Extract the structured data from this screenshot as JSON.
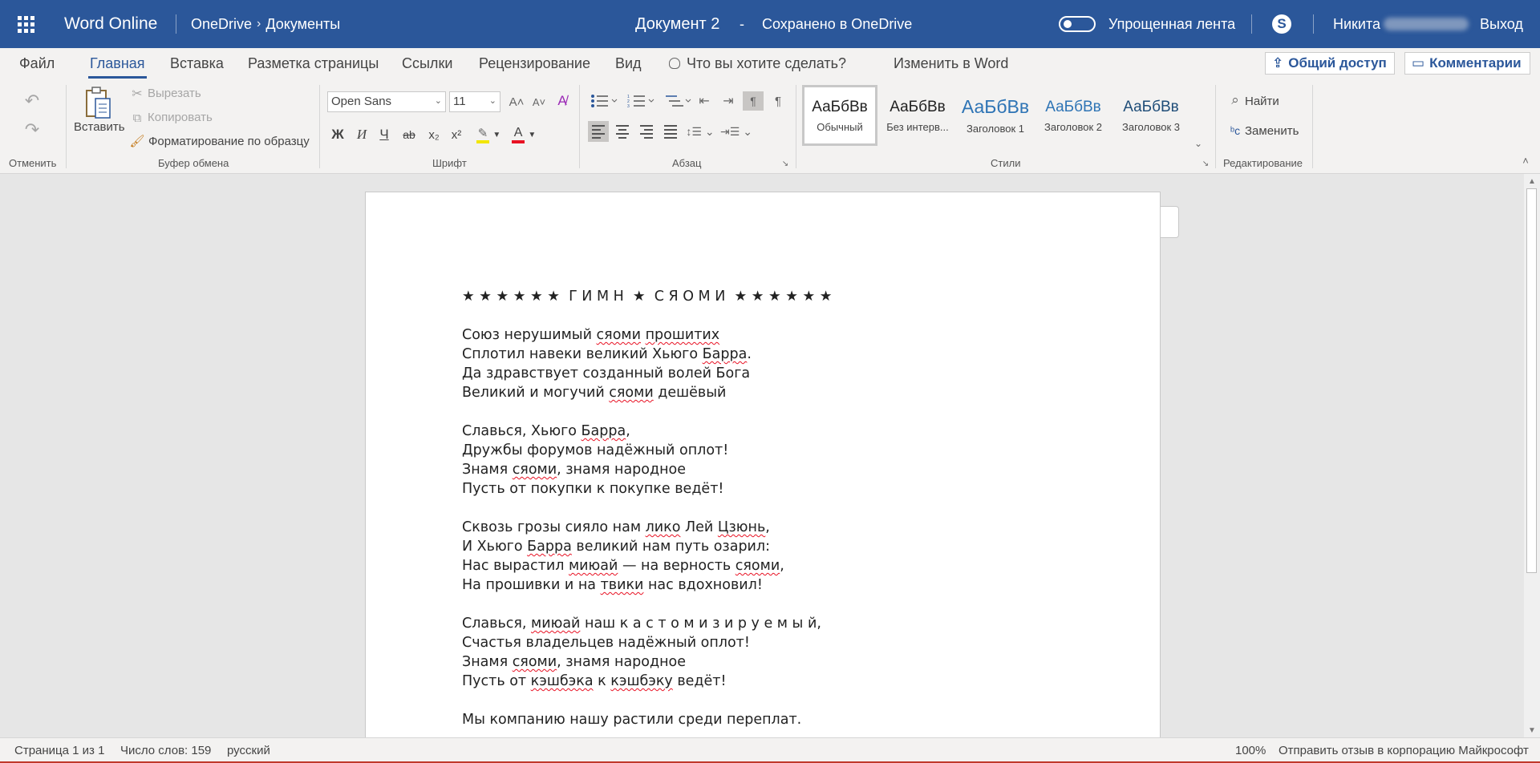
{
  "topbar": {
    "app_name": "Word Online",
    "breadcrumb_root": "OneDrive",
    "breadcrumb_folder": "Документы",
    "doc_title": "Документ 2",
    "separator": "-",
    "save_status": "Сохранено в OneDrive",
    "simplified_ribbon_label": "Упрощенная лента",
    "simplified_ribbon_on": false,
    "user_name": "Никита",
    "logout": "Выход"
  },
  "menu": {
    "tabs": [
      "Файл",
      "Главная",
      "Вставка",
      "Разметка страницы",
      "Ссылки",
      "Рецензирование",
      "Вид"
    ],
    "active_tab": "Главная",
    "tell_me": "Что вы хотите сделать?",
    "edit_in_word": "Изменить в Word",
    "share": "Общий доступ",
    "comments": "Комментарии"
  },
  "ribbon": {
    "undo_group": "Отменить",
    "clipboard": {
      "paste": "Вставить",
      "cut": "Вырезать",
      "copy": "Копировать",
      "format_painter": "Форматирование по образцу",
      "label": "Буфер обмена"
    },
    "font": {
      "family": "Open Sans",
      "size": "11",
      "bold": "Ж",
      "italic": "И",
      "underline": "Ч",
      "strike": "ab",
      "label": "Шрифт"
    },
    "paragraph_label": "Абзац",
    "styles": {
      "items": [
        {
          "sample": "АаБбВв",
          "name": "Обычный"
        },
        {
          "sample": "АаБбВв",
          "name": "Без интерв..."
        },
        {
          "sample": "АаБбВв",
          "name": "Заголовок 1"
        },
        {
          "sample": "АаБбВв",
          "name": "Заголовок 2"
        },
        {
          "sample": "АаБбВв",
          "name": "Заголовок 3"
        }
      ],
      "label": "Стили"
    },
    "editing": {
      "find": "Найти",
      "replace": "Заменить",
      "label": "Редактирование"
    }
  },
  "document": {
    "title_line": "★ ★ ★ ★ ★ ★  Г И М Н  ★  С Я О М И  ★ ★ ★ ★ ★ ★",
    "stanzas": [
      [
        "Союз нерушимый сяоми прошитих",
        "Сплотил навеки великий Хьюго Барра.",
        "Да здравствует созданный волей Бога",
        "Великий и могучий сяоми дешёвый"
      ],
      [
        "Славься, Хьюго Барра,",
        "Дружбы форумов надёжный оплот!",
        "Знамя сяоми, знамя народное",
        "Пусть от покупки к покупке ведёт!"
      ],
      [
        "Сквозь грозы сияло нам лико Лей Цзюнь,",
        "И Хьюго Барра великий нам путь озарил:",
        "Нас вырастил миюай — на верность сяоми,",
        "На прошивки и на твики нас вдохновил!"
      ],
      [
        "Славься, миюай наш к а с т о м и з и р у е м ы й,",
        "Счастья владельцев надёжный оплот!",
        "Знамя сяоми, знамя народное",
        "Пусть от кэшбэка к кэшбэку ведёт!"
      ],
      [
        "Мы компанию нашу растили среди переплат."
      ]
    ]
  },
  "status": {
    "page": "Страница 1 из 1",
    "words": "Число слов: 159",
    "language": "русский",
    "zoom": "100%",
    "feedback": "Отправить отзыв в корпорацию Майкрософт"
  }
}
